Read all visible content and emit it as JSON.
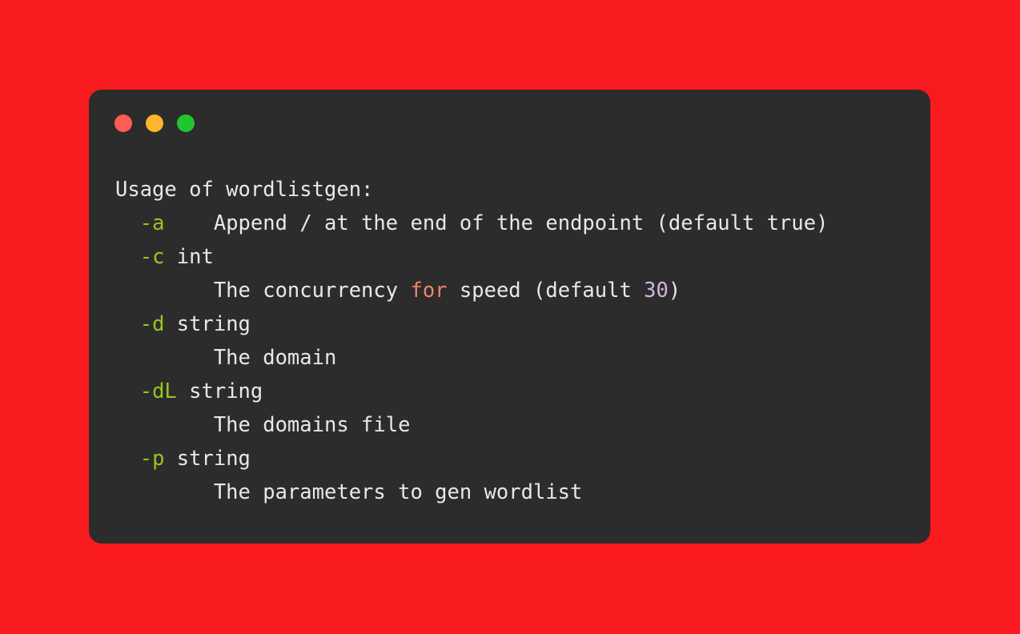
{
  "window": {
    "kind": "terminal-window",
    "background_color": "#2c2c2c",
    "page_background_color": "#f81a1f",
    "controls": [
      {
        "name": "close",
        "color": "#fd5d55"
      },
      {
        "name": "minimize",
        "color": "#fdb62b"
      },
      {
        "name": "maximize",
        "color": "#22c52e"
      }
    ]
  },
  "palette": {
    "text": "#e9e9e4",
    "flag": "#96c524",
    "keyword": "#f08463",
    "number": "#d4b3e0"
  },
  "terminal": {
    "program": "wordlistgen",
    "heading": "Usage of wordlistgen:",
    "lines": [
      {
        "id": "heading",
        "tokens": [
          {
            "text": "Usage of wordlistgen:",
            "type": "plain"
          }
        ]
      },
      {
        "id": "flag-a",
        "tokens": [
          {
            "text": "  ",
            "type": "plain"
          },
          {
            "text": "-a",
            "type": "flag"
          },
          {
            "text": "    Append / at the end of the endpoint (default true)",
            "type": "plain"
          }
        ]
      },
      {
        "id": "flag-c",
        "tokens": [
          {
            "text": "  ",
            "type": "plain"
          },
          {
            "text": "-c",
            "type": "flag"
          },
          {
            "text": " int",
            "type": "plain"
          }
        ]
      },
      {
        "id": "flag-c-desc",
        "tokens": [
          {
            "text": "        The concurrency ",
            "type": "plain"
          },
          {
            "text": "for",
            "type": "keyword"
          },
          {
            "text": " speed (default ",
            "type": "plain"
          },
          {
            "text": "30",
            "type": "number"
          },
          {
            "text": ")",
            "type": "plain"
          }
        ]
      },
      {
        "id": "flag-d",
        "tokens": [
          {
            "text": "  ",
            "type": "plain"
          },
          {
            "text": "-d",
            "type": "flag"
          },
          {
            "text": " string",
            "type": "plain"
          }
        ]
      },
      {
        "id": "flag-d-desc",
        "tokens": [
          {
            "text": "        The domain",
            "type": "plain"
          }
        ]
      },
      {
        "id": "flag-dL",
        "tokens": [
          {
            "text": "  ",
            "type": "plain"
          },
          {
            "text": "-dL",
            "type": "flag"
          },
          {
            "text": " string",
            "type": "plain"
          }
        ]
      },
      {
        "id": "flag-dL-desc",
        "tokens": [
          {
            "text": "        The domains file",
            "type": "plain"
          }
        ]
      },
      {
        "id": "flag-p",
        "tokens": [
          {
            "text": "  ",
            "type": "plain"
          },
          {
            "text": "-p",
            "type": "flag"
          },
          {
            "text": " string",
            "type": "plain"
          }
        ]
      },
      {
        "id": "flag-p-desc",
        "tokens": [
          {
            "text": "        The parameters to gen wordlist",
            "type": "plain"
          }
        ]
      }
    ]
  }
}
